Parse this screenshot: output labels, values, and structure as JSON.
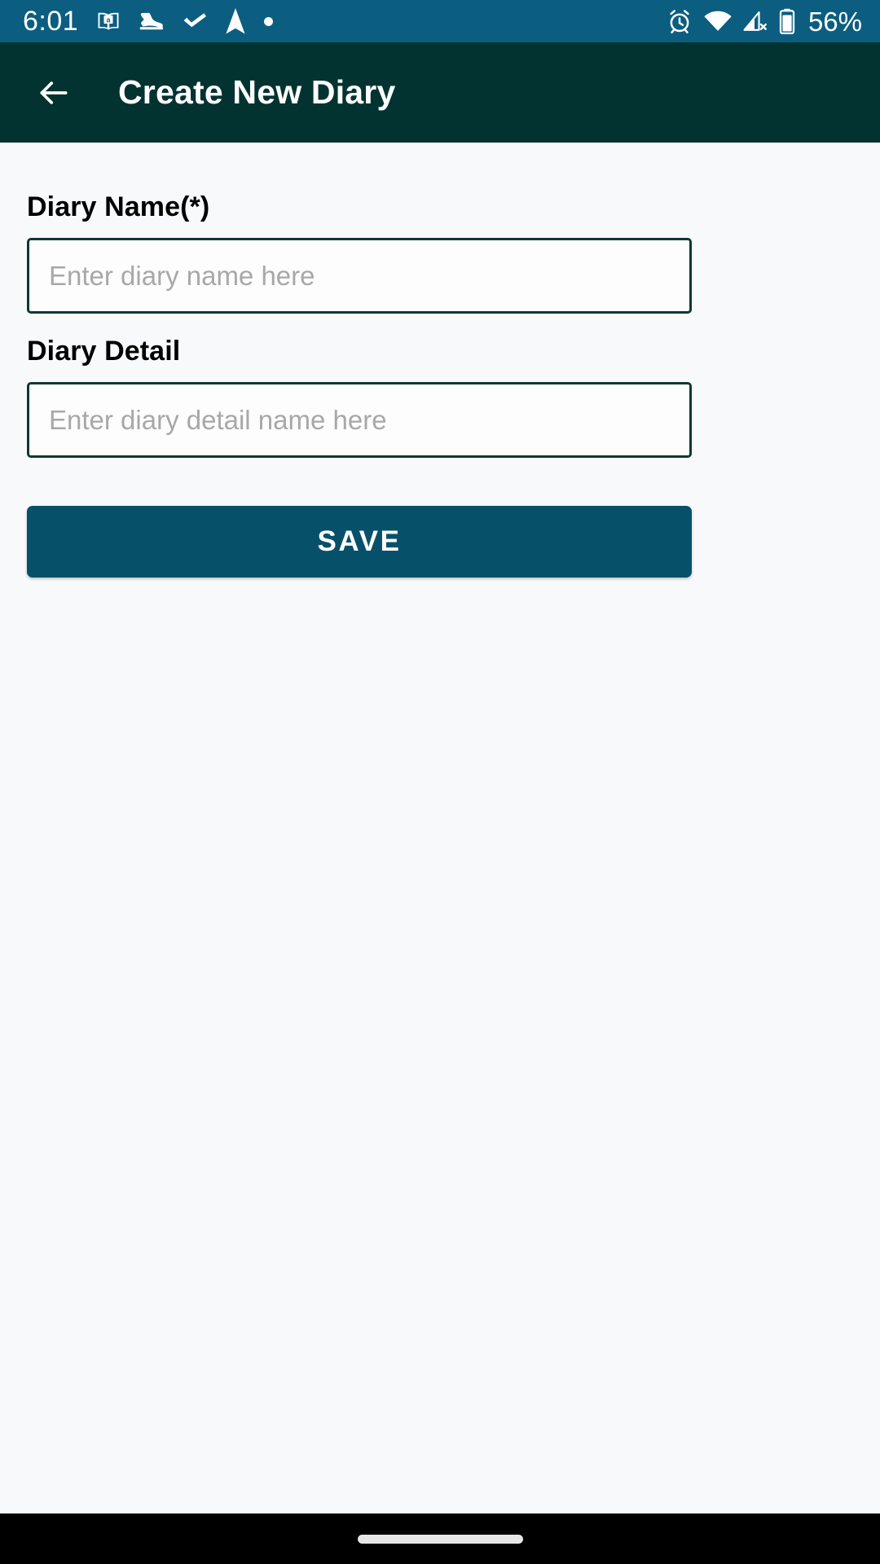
{
  "status_bar": {
    "clock": "6:01",
    "battery_percent": "56%",
    "background_color": "#0b5e80",
    "left_icons": [
      {
        "name": "kindle-book-icon",
        "glyph": "book"
      },
      {
        "name": "sneaker-shoe-icon",
        "glyph": "shoe"
      },
      {
        "name": "checkmark-icon",
        "glyph": "check"
      },
      {
        "name": "navigation-arrow-icon",
        "glyph": "arrow"
      },
      {
        "name": "dot-indicator-icon",
        "glyph": "dot"
      }
    ],
    "right_icons": [
      {
        "name": "alarm-clock-icon",
        "glyph": "alarm"
      },
      {
        "name": "wifi-icon",
        "glyph": "wifi"
      },
      {
        "name": "cellular-no-signal-icon",
        "glyph": "signal-off"
      },
      {
        "name": "battery-icon",
        "glyph": "battery"
      }
    ]
  },
  "app_bar": {
    "title": "Create New Diary",
    "back_label": "Back",
    "background_color": "#033330"
  },
  "form": {
    "diary_name": {
      "label": "Diary Name(*)",
      "placeholder": "Enter diary name here",
      "value": ""
    },
    "diary_detail": {
      "label": "Diary Detail",
      "placeholder": "Enter diary detail name here",
      "value": ""
    },
    "save_label": "SAVE",
    "save_color": "#07506a",
    "input_border_color": "#0d3833"
  },
  "nav_bar": {
    "gesture_hint": "Home gesture bar"
  }
}
